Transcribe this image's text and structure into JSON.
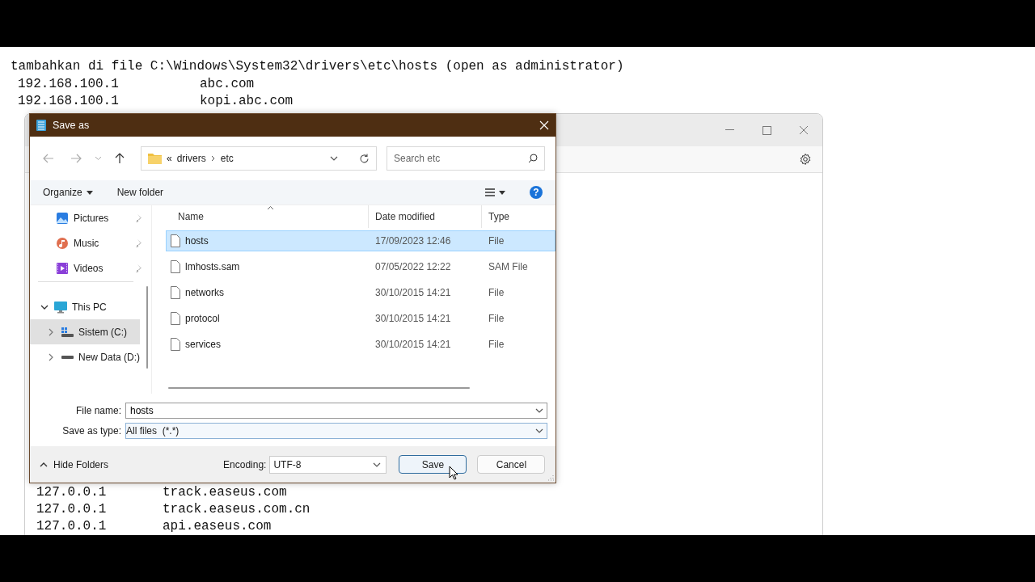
{
  "instructions": {
    "text": "tambahkan di file C:\\Windows\\System32\\drivers\\etc\\hosts (open as administrator)",
    "entries": [
      {
        "ip": "192.168.100.1",
        "host": "abc.com"
      },
      {
        "ip": "192.168.100.1",
        "host": "kopi.abc.com"
      }
    ]
  },
  "notepad": {
    "lines": [
      {
        "ip": "127.0.0.1",
        "host": "track.easeus.com"
      },
      {
        "ip": "127.0.0.1",
        "host": "track.easeus.com.cn"
      },
      {
        "ip": "127.0.0.1",
        "host": "api.easeus.com"
      }
    ]
  },
  "dialog": {
    "title": "Save as",
    "address": {
      "overflow": "«",
      "segments": [
        "drivers",
        "etc"
      ]
    },
    "search": {
      "placeholder": "Search etc"
    },
    "commands": [
      {
        "label": "Organize",
        "kind": "menu"
      },
      {
        "label": "New folder",
        "kind": "button"
      }
    ],
    "sidebar": {
      "quick_access": [
        {
          "label": "Pictures",
          "kind": "pictures",
          "pinned": true
        },
        {
          "label": "Music",
          "kind": "music",
          "pinned": true
        },
        {
          "label": "Videos",
          "kind": "videos",
          "pinned": true
        }
      ],
      "tree": [
        {
          "label": "This PC",
          "kind": "pc",
          "expanded": true,
          "selected": false,
          "children": [
            {
              "label": "Sistem (C:)",
              "kind": "system-drive",
              "expanded": false,
              "selected": true
            },
            {
              "label": "New Data (D:)",
              "kind": "drive",
              "expanded": false,
              "selected": false
            }
          ]
        }
      ]
    },
    "columns": [
      "Name",
      "Date modified",
      "Type"
    ],
    "rows": [
      {
        "name": "hosts",
        "date": "17/09/2023 12:46",
        "type": "File",
        "selected": true
      },
      {
        "name": "lmhosts.sam",
        "date": "07/05/2022 12:22",
        "type": "SAM File",
        "selected": false
      },
      {
        "name": "networks",
        "date": "30/10/2015 14:21",
        "type": "File",
        "selected": false
      },
      {
        "name": "protocol",
        "date": "30/10/2015 14:21",
        "type": "File",
        "selected": false
      },
      {
        "name": "services",
        "date": "30/10/2015 14:21",
        "type": "File",
        "selected": false
      }
    ],
    "file_name": {
      "label": "File name:",
      "value": "hosts"
    },
    "save_as_type": {
      "label": "Save as type:",
      "value": "All files  (*.*)"
    },
    "help": "?",
    "hide_folders": "Hide Folders",
    "encoding": {
      "label": "Encoding:",
      "value": "UTF-8"
    },
    "buttons": [
      {
        "label": "Save",
        "default": true
      },
      {
        "label": "Cancel",
        "default": false
      }
    ]
  }
}
